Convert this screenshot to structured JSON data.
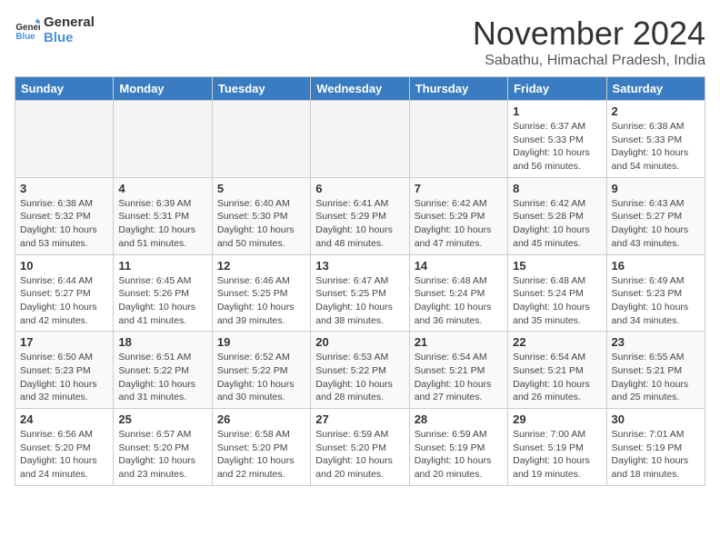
{
  "logo": {
    "line1": "General",
    "line2": "Blue"
  },
  "title": "November 2024",
  "location": "Sabathu, Himachal Pradesh, India",
  "weekdays": [
    "Sunday",
    "Monday",
    "Tuesday",
    "Wednesday",
    "Thursday",
    "Friday",
    "Saturday"
  ],
  "weeks": [
    [
      {
        "day": "",
        "info": ""
      },
      {
        "day": "",
        "info": ""
      },
      {
        "day": "",
        "info": ""
      },
      {
        "day": "",
        "info": ""
      },
      {
        "day": "",
        "info": ""
      },
      {
        "day": "1",
        "info": "Sunrise: 6:37 AM\nSunset: 5:33 PM\nDaylight: 10 hours and 56 minutes."
      },
      {
        "day": "2",
        "info": "Sunrise: 6:38 AM\nSunset: 5:33 PM\nDaylight: 10 hours and 54 minutes."
      }
    ],
    [
      {
        "day": "3",
        "info": "Sunrise: 6:38 AM\nSunset: 5:32 PM\nDaylight: 10 hours and 53 minutes."
      },
      {
        "day": "4",
        "info": "Sunrise: 6:39 AM\nSunset: 5:31 PM\nDaylight: 10 hours and 51 minutes."
      },
      {
        "day": "5",
        "info": "Sunrise: 6:40 AM\nSunset: 5:30 PM\nDaylight: 10 hours and 50 minutes."
      },
      {
        "day": "6",
        "info": "Sunrise: 6:41 AM\nSunset: 5:29 PM\nDaylight: 10 hours and 48 minutes."
      },
      {
        "day": "7",
        "info": "Sunrise: 6:42 AM\nSunset: 5:29 PM\nDaylight: 10 hours and 47 minutes."
      },
      {
        "day": "8",
        "info": "Sunrise: 6:42 AM\nSunset: 5:28 PM\nDaylight: 10 hours and 45 minutes."
      },
      {
        "day": "9",
        "info": "Sunrise: 6:43 AM\nSunset: 5:27 PM\nDaylight: 10 hours and 43 minutes."
      }
    ],
    [
      {
        "day": "10",
        "info": "Sunrise: 6:44 AM\nSunset: 5:27 PM\nDaylight: 10 hours and 42 minutes."
      },
      {
        "day": "11",
        "info": "Sunrise: 6:45 AM\nSunset: 5:26 PM\nDaylight: 10 hours and 41 minutes."
      },
      {
        "day": "12",
        "info": "Sunrise: 6:46 AM\nSunset: 5:25 PM\nDaylight: 10 hours and 39 minutes."
      },
      {
        "day": "13",
        "info": "Sunrise: 6:47 AM\nSunset: 5:25 PM\nDaylight: 10 hours and 38 minutes."
      },
      {
        "day": "14",
        "info": "Sunrise: 6:48 AM\nSunset: 5:24 PM\nDaylight: 10 hours and 36 minutes."
      },
      {
        "day": "15",
        "info": "Sunrise: 6:48 AM\nSunset: 5:24 PM\nDaylight: 10 hours and 35 minutes."
      },
      {
        "day": "16",
        "info": "Sunrise: 6:49 AM\nSunset: 5:23 PM\nDaylight: 10 hours and 34 minutes."
      }
    ],
    [
      {
        "day": "17",
        "info": "Sunrise: 6:50 AM\nSunset: 5:23 PM\nDaylight: 10 hours and 32 minutes."
      },
      {
        "day": "18",
        "info": "Sunrise: 6:51 AM\nSunset: 5:22 PM\nDaylight: 10 hours and 31 minutes."
      },
      {
        "day": "19",
        "info": "Sunrise: 6:52 AM\nSunset: 5:22 PM\nDaylight: 10 hours and 30 minutes."
      },
      {
        "day": "20",
        "info": "Sunrise: 6:53 AM\nSunset: 5:22 PM\nDaylight: 10 hours and 28 minutes."
      },
      {
        "day": "21",
        "info": "Sunrise: 6:54 AM\nSunset: 5:21 PM\nDaylight: 10 hours and 27 minutes."
      },
      {
        "day": "22",
        "info": "Sunrise: 6:54 AM\nSunset: 5:21 PM\nDaylight: 10 hours and 26 minutes."
      },
      {
        "day": "23",
        "info": "Sunrise: 6:55 AM\nSunset: 5:21 PM\nDaylight: 10 hours and 25 minutes."
      }
    ],
    [
      {
        "day": "24",
        "info": "Sunrise: 6:56 AM\nSunset: 5:20 PM\nDaylight: 10 hours and 24 minutes."
      },
      {
        "day": "25",
        "info": "Sunrise: 6:57 AM\nSunset: 5:20 PM\nDaylight: 10 hours and 23 minutes."
      },
      {
        "day": "26",
        "info": "Sunrise: 6:58 AM\nSunset: 5:20 PM\nDaylight: 10 hours and 22 minutes."
      },
      {
        "day": "27",
        "info": "Sunrise: 6:59 AM\nSunset: 5:20 PM\nDaylight: 10 hours and 20 minutes."
      },
      {
        "day": "28",
        "info": "Sunrise: 6:59 AM\nSunset: 5:19 PM\nDaylight: 10 hours and 20 minutes."
      },
      {
        "day": "29",
        "info": "Sunrise: 7:00 AM\nSunset: 5:19 PM\nDaylight: 10 hours and 19 minutes."
      },
      {
        "day": "30",
        "info": "Sunrise: 7:01 AM\nSunset: 5:19 PM\nDaylight: 10 hours and 18 minutes."
      }
    ]
  ]
}
